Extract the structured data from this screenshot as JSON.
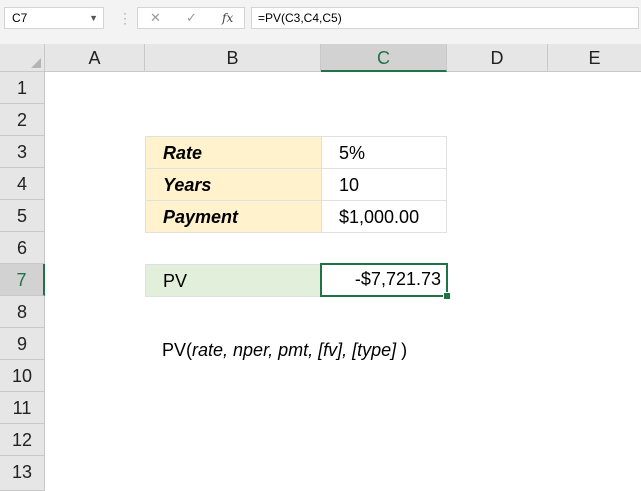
{
  "formula_bar": {
    "name_box": "C7",
    "cancel_symbol": "✕",
    "enter_symbol": "✓",
    "fx_label": "fx",
    "formula": "=PV(C3,C4,C5)"
  },
  "columns": [
    "A",
    "B",
    "C",
    "D",
    "E"
  ],
  "rows": [
    "1",
    "2",
    "3",
    "4",
    "5",
    "6",
    "7",
    "8",
    "9",
    "10",
    "11",
    "12",
    "13"
  ],
  "selected": {
    "column": "C",
    "row": "7"
  },
  "table": {
    "rate_label": "Rate",
    "rate_value": "5%",
    "years_label": "Years",
    "years_value": "10",
    "payment_label": "Payment",
    "payment_value": "$1,000.00"
  },
  "result": {
    "label": "PV",
    "value": "-$7,721.73"
  },
  "syntax": {
    "prefix": "PV(",
    "args": "rate, nper, pmt, [fv], [type]",
    "suffix": " )"
  },
  "colors": {
    "accent": "#217346",
    "input_fill": "#fff2cc",
    "output_fill": "#e2efda"
  }
}
